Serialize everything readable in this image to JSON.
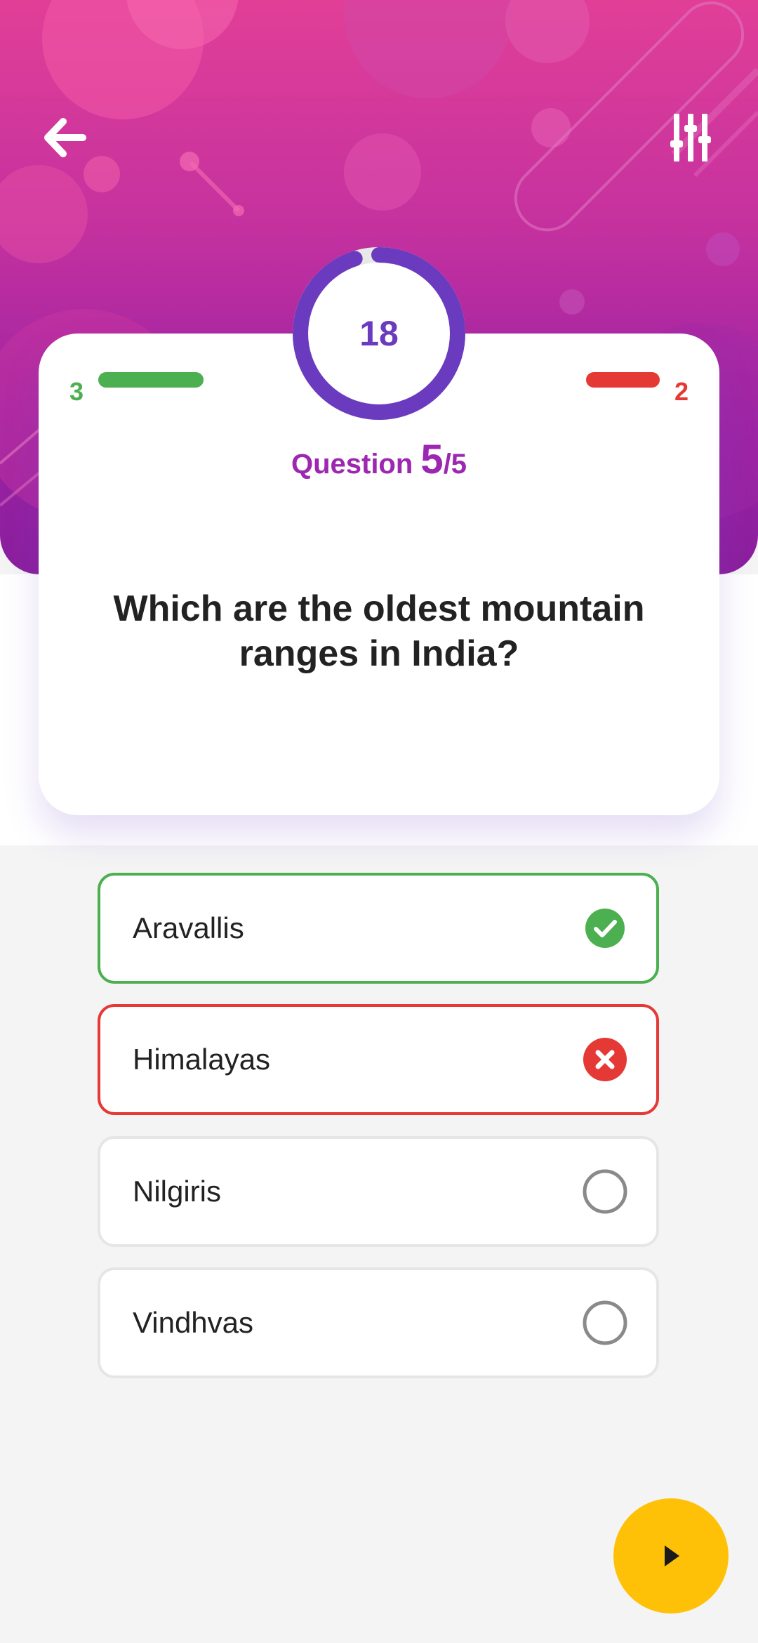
{
  "scores": {
    "correct": "3",
    "wrong": "2"
  },
  "timer": {
    "value": "18",
    "remaining_fraction": 0.95
  },
  "question": {
    "label": "Question",
    "current": "5",
    "total": "/5",
    "text": "Which are the oldest mountain ranges in India?"
  },
  "options": [
    {
      "label": "Aravallis",
      "state": "correct"
    },
    {
      "label": "Himalayas",
      "state": "wrong"
    },
    {
      "label": "Nilgiris",
      "state": "none"
    },
    {
      "label": "Vindhvas",
      "state": "none"
    }
  ],
  "icons": {
    "back": "back-arrow-icon",
    "settings": "sliders-icon",
    "next": "play-icon",
    "correct": "check-circle-icon",
    "wrong": "close-circle-icon",
    "unselected": "radio-empty-icon"
  },
  "colors": {
    "header_pink": "#e13f97",
    "header_purple": "#8a1f9e",
    "correct": "#4caf50",
    "wrong": "#e53935",
    "timer": "#6a3bbf",
    "question_count": "#9c27b0",
    "next_button": "#ffc107"
  }
}
